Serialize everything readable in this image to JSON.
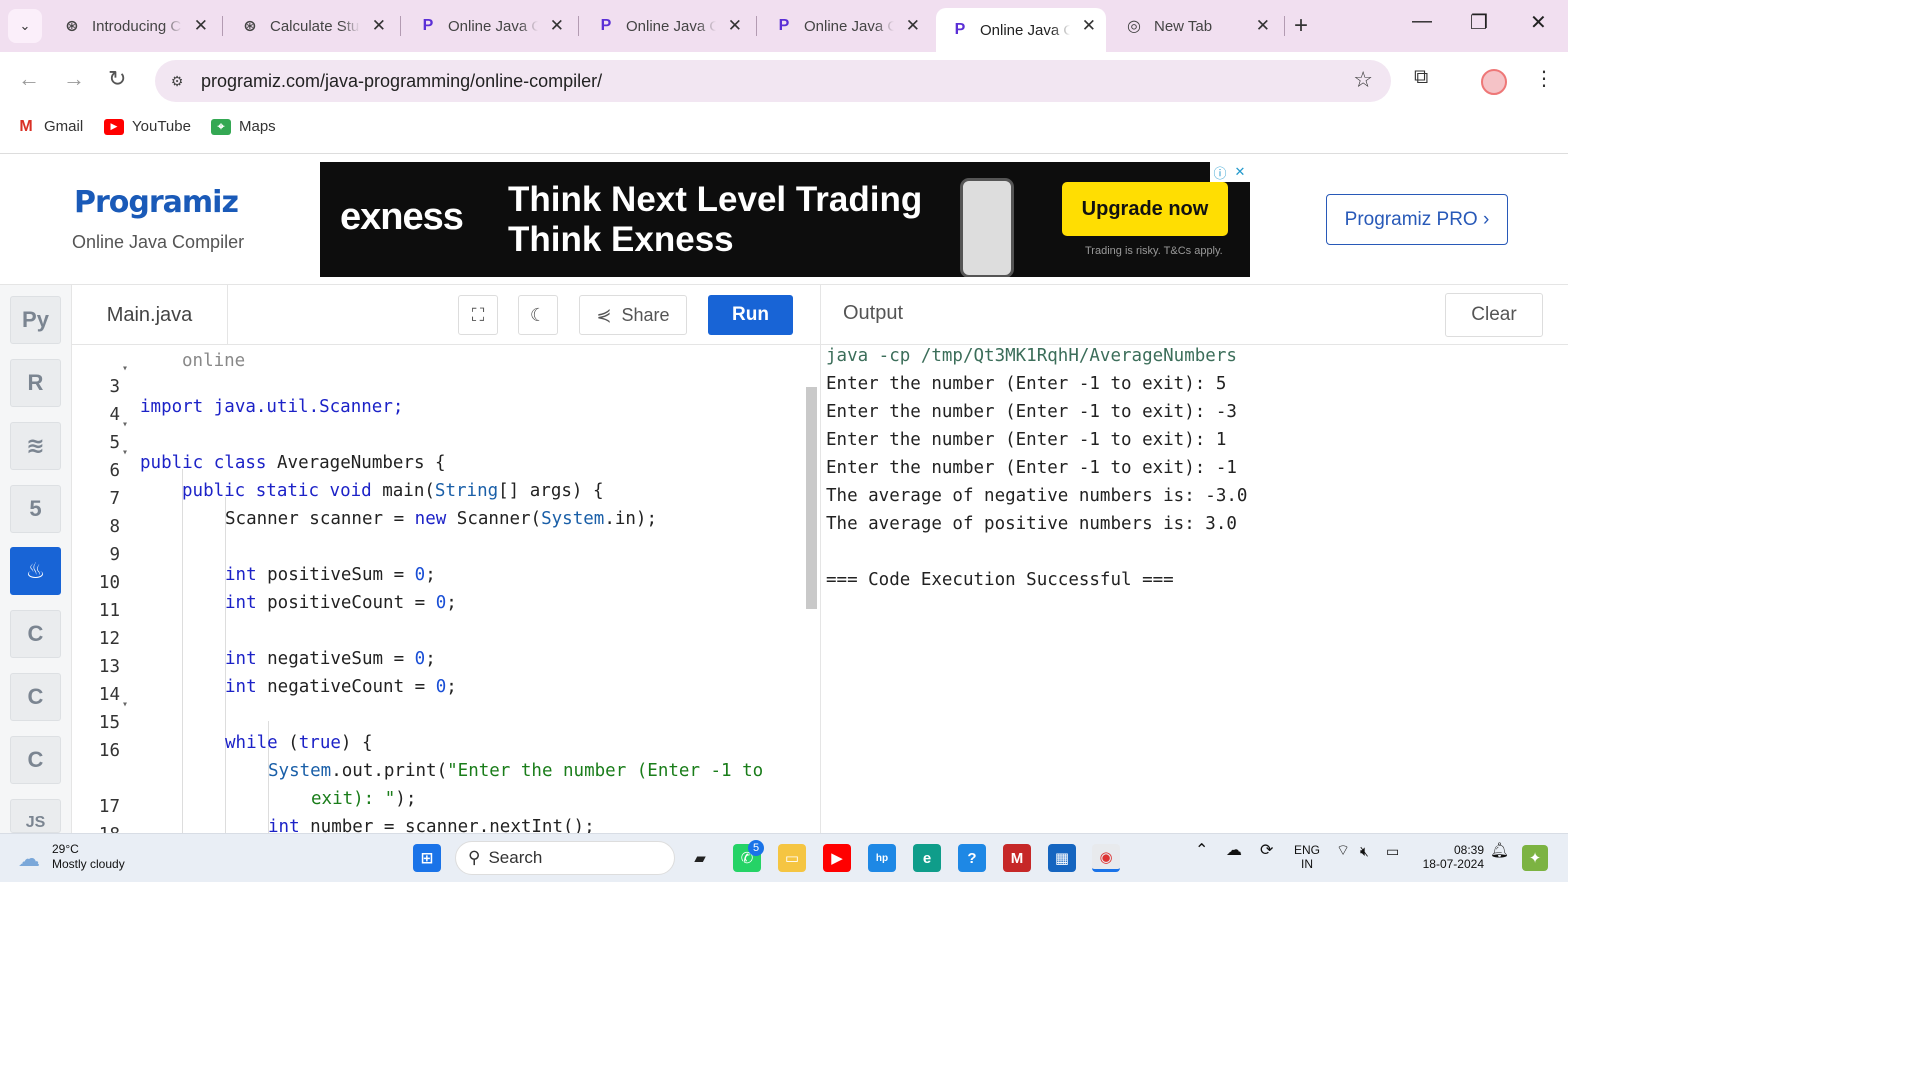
{
  "tabs": [
    {
      "title": "Introducing ChatGPT",
      "icon": "openai-icon"
    },
    {
      "title": "Calculate Student",
      "icon": "openai-icon"
    },
    {
      "title": "Online Java Compiler",
      "icon": "programiz-icon"
    },
    {
      "title": "Online Java Compiler",
      "icon": "programiz-icon"
    },
    {
      "title": "Online Java Compiler",
      "icon": "programiz-icon"
    },
    {
      "title": "Online Java Compiler",
      "icon": "programiz-icon"
    },
    {
      "title": "New Tab",
      "icon": "chrome-icon"
    }
  ],
  "address": {
    "url": "programiz.com/java-programming/online-compiler/"
  },
  "bookmarks": [
    {
      "label": "Gmail"
    },
    {
      "label": "YouTube"
    },
    {
      "label": "Maps"
    }
  ],
  "site": {
    "logo": "Programiz",
    "subtitle": "Online Java Compiler",
    "pro_button": "Programiz PRO ›"
  },
  "ad": {
    "brand": "exness",
    "headline1": "Think Next Level Trading",
    "headline2": "Think Exness",
    "cta": "Upgrade now",
    "fine_print": "Trading is risky. T&Cs apply."
  },
  "editor": {
    "filename": "Main.java",
    "share_label": "Share",
    "run_label": "Run",
    "partial_top_line": "online",
    "lines": [
      {
        "n": "3",
        "fold": true
      },
      {
        "n": "4",
        "fold": false
      },
      {
        "n": "5",
        "fold": true
      },
      {
        "n": "6",
        "fold": true
      },
      {
        "n": "7",
        "fold": false
      },
      {
        "n": "8",
        "fold": false
      },
      {
        "n": "9",
        "fold": false
      },
      {
        "n": "10",
        "fold": false
      },
      {
        "n": "11",
        "fold": false
      },
      {
        "n": "12",
        "fold": false
      },
      {
        "n": "13",
        "fold": false
      },
      {
        "n": "14",
        "fold": false
      },
      {
        "n": "15",
        "fold": true
      },
      {
        "n": "16",
        "fold": false
      },
      {
        "n": "",
        "fold": false
      },
      {
        "n": "17",
        "fold": false
      },
      {
        "n": "18",
        "fold": false
      }
    ],
    "code": {
      "l3": "import java.util.Scanner;",
      "l5a": "public",
      "l5b": "class",
      "l5c": "AverageNumbers {",
      "l6a": "public",
      "l6b": "static",
      "l6c": "void",
      "l6d": "main(",
      "l6e": "String",
      "l6f": "[] args) {",
      "l7a": "Scanner scanner = ",
      "l7b": "new",
      "l7c": " Scanner(",
      "l7d": "System",
      "l7e": ".in);",
      "l9a": "int",
      "l9b": " positiveSum = ",
      "l9c": "0",
      "l10a": "int",
      "l10b": " positiveCount = ",
      "l10c": "0",
      "l12a": "int",
      "l12b": " negativeSum = ",
      "l12c": "0",
      "l13a": "int",
      "l13b": " negativeCount = ",
      "l13c": "0",
      "l15a": "while",
      "l15b": " (",
      "l15c": "true",
      "l15d": ") {",
      "l16a": "System",
      "l16b": ".out.print(",
      "l16c": "\"Enter the number (Enter -1 to",
      "l16d": "exit): \"",
      "l16e": ");",
      "l17a": "int",
      "l17b": " number = scanner.nextInt();",
      "semi": ";"
    }
  },
  "output": {
    "title": "Output",
    "clear_label": "Clear",
    "lines": [
      "java -cp /tmp/Qt3MK1RqhH/AverageNumbers",
      "Enter the number (Enter -1 to exit): 5",
      "Enter the number (Enter -1 to exit): -3",
      "Enter the number (Enter -1 to exit): 1",
      "Enter the number (Enter -1 to exit): -1",
      "The average of negative numbers is: -3.0",
      "The average of positive numbers is: 3.0",
      "",
      "=== Code Execution Successful ==="
    ]
  },
  "languages": [
    {
      "name": "python-icon",
      "glyph": "Py"
    },
    {
      "name": "r-icon",
      "glyph": "R"
    },
    {
      "name": "sql-icon",
      "glyph": "≋"
    },
    {
      "name": "html5-icon",
      "glyph": "5"
    },
    {
      "name": "java-icon",
      "glyph": "♨"
    },
    {
      "name": "c-icon",
      "glyph": "C"
    },
    {
      "name": "cpp-icon",
      "glyph": "C"
    },
    {
      "name": "csharp-icon",
      "glyph": "C"
    },
    {
      "name": "js-icon",
      "glyph": "JS"
    }
  ],
  "taskbar": {
    "temperature": "29°C",
    "weather": "Mostly cloudy",
    "search_label": "Search",
    "lang1": "ENG",
    "lang2": "IN",
    "time": "08:39",
    "date": "18-07-2024",
    "whatsapp_badge": "5"
  },
  "colors": {
    "accent": "#1864d6",
    "tabbar": "#f1dff0"
  }
}
